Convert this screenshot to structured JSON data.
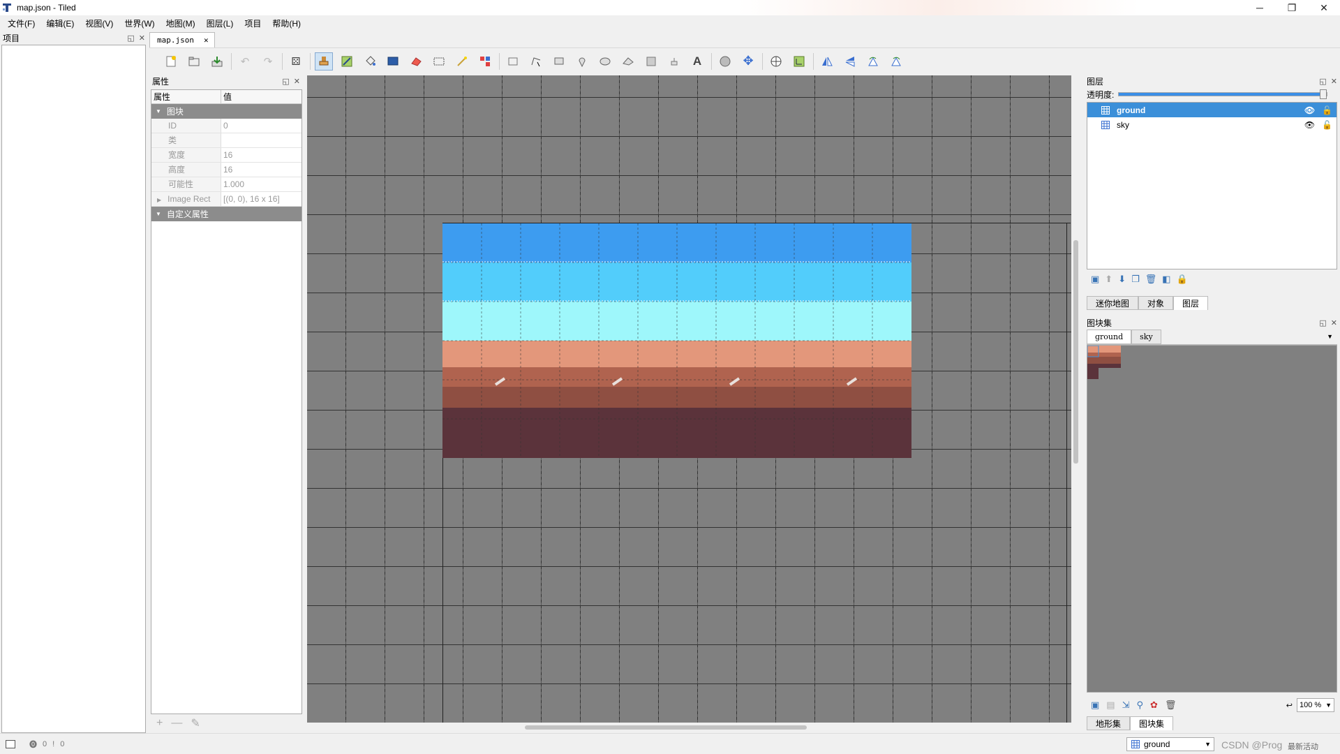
{
  "window": {
    "title": "map.json - Tiled",
    "controls": {
      "minimize": "─",
      "maximize": "❐",
      "close": "✕"
    }
  },
  "menu": [
    "文件(F)",
    "编辑(E)",
    "视图(V)",
    "世界(W)",
    "地图(M)",
    "图层(L)",
    "项目",
    "帮助(H)"
  ],
  "project_panel": {
    "title": "项目"
  },
  "document_tab": {
    "label": "map.json",
    "close": "✕"
  },
  "properties": {
    "title": "属性",
    "col_name": "属性",
    "col_value": "值",
    "group_tile": "图块",
    "rows": [
      {
        "key": "ID",
        "value": "0"
      },
      {
        "key": "类",
        "value": ""
      },
      {
        "key": "宽度",
        "value": "16"
      },
      {
        "key": "高度",
        "value": "16"
      },
      {
        "key": "可能性",
        "value": "1.000"
      }
    ],
    "image_rect": {
      "key": "Image Rect",
      "value": "[(0, 0), 16 x 16]"
    },
    "group_custom": "自定义属性",
    "footer": {
      "add": "+",
      "remove": "—",
      "edit": "✎"
    }
  },
  "layers": {
    "title": "图层",
    "opacity_label": "透明度:",
    "opacity": 1.0,
    "items": [
      {
        "name": "ground",
        "selected": true
      },
      {
        "name": "sky",
        "selected": false
      }
    ],
    "tabs": [
      "迷你地图",
      "对象",
      "图层"
    ],
    "active_tab": "图层"
  },
  "tilesets": {
    "title": "图块集",
    "tabs": [
      "ground",
      "sky"
    ],
    "bottom_tabs": [
      "地形集",
      "图块集"
    ],
    "zoom": "100 %"
  },
  "statusbar": {
    "warnings": "0",
    "errors": "0",
    "current_layer": "ground",
    "watermark": "CSDN @Prog",
    "extra": "最新活动"
  },
  "colors": {
    "accent": "#3b8fd9",
    "canvas": "#808080",
    "sky_top": "#3d9cf0",
    "sky_mid": "#52cdfb",
    "sky_low": "#9ef7fb",
    "ground_top": "#e3977b",
    "ground_mid": "#b0634f",
    "ground_dark": "#8f4f42",
    "ground_deep": "#5b333b"
  }
}
